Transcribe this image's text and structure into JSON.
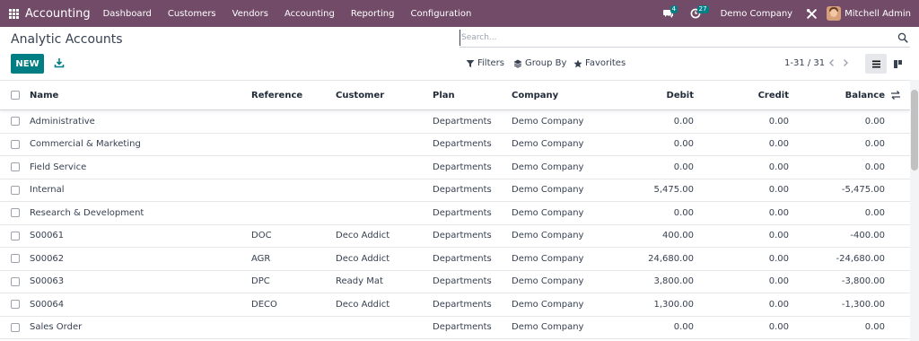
{
  "navbar": {
    "brand": "Accounting",
    "menu": [
      "Dashboard",
      "Customers",
      "Vendors",
      "Accounting",
      "Reporting",
      "Configuration"
    ],
    "messages_count": "4",
    "activities_count": "27",
    "company": "Demo Company",
    "user": "Mitchell Admin"
  },
  "page": {
    "title": "Analytic Accounts",
    "search_placeholder": "Search...",
    "new_label": "NEW",
    "filters_label": "Filters",
    "group_by_label": "Group By",
    "favorites_label": "Favorites",
    "pager": "1-31 / 31"
  },
  "table": {
    "columns": [
      "Name",
      "Reference",
      "Customer",
      "Plan",
      "Company",
      "Debit",
      "Credit",
      "Balance"
    ],
    "rows": [
      {
        "name": "Administrative",
        "reference": "",
        "customer": "",
        "plan": "Departments",
        "company": "Demo Company",
        "debit": "0.00",
        "credit": "0.00",
        "balance": "0.00"
      },
      {
        "name": "Commercial & Marketing",
        "reference": "",
        "customer": "",
        "plan": "Departments",
        "company": "Demo Company",
        "debit": "0.00",
        "credit": "0.00",
        "balance": "0.00"
      },
      {
        "name": "Field Service",
        "reference": "",
        "customer": "",
        "plan": "Departments",
        "company": "Demo Company",
        "debit": "0.00",
        "credit": "0.00",
        "balance": "0.00"
      },
      {
        "name": "Internal",
        "reference": "",
        "customer": "",
        "plan": "Departments",
        "company": "Demo Company",
        "debit": "5,475.00",
        "credit": "0.00",
        "balance": "-5,475.00"
      },
      {
        "name": "Research & Development",
        "reference": "",
        "customer": "",
        "plan": "Departments",
        "company": "Demo Company",
        "debit": "0.00",
        "credit": "0.00",
        "balance": "0.00"
      },
      {
        "name": "S00061",
        "reference": "DOC",
        "customer": "Deco Addict",
        "plan": "Departments",
        "company": "Demo Company",
        "debit": "400.00",
        "credit": "0.00",
        "balance": "-400.00"
      },
      {
        "name": "S00062",
        "reference": "AGR",
        "customer": "Deco Addict",
        "plan": "Departments",
        "company": "Demo Company",
        "debit": "24,680.00",
        "credit": "0.00",
        "balance": "-24,680.00"
      },
      {
        "name": "S00063",
        "reference": "DPC",
        "customer": "Ready Mat",
        "plan": "Departments",
        "company": "Demo Company",
        "debit": "3,800.00",
        "credit": "0.00",
        "balance": "-3,800.00"
      },
      {
        "name": "S00064",
        "reference": "DECO",
        "customer": "Deco Addict",
        "plan": "Departments",
        "company": "Demo Company",
        "debit": "1,300.00",
        "credit": "0.00",
        "balance": "-1,300.00"
      },
      {
        "name": "Sales Order",
        "reference": "",
        "customer": "",
        "plan": "Departments",
        "company": "Demo Company",
        "debit": "0.00",
        "credit": "0.00",
        "balance": "0.00"
      }
    ]
  },
  "colors": {
    "navbar": "#714b67",
    "primary": "#017e84"
  }
}
